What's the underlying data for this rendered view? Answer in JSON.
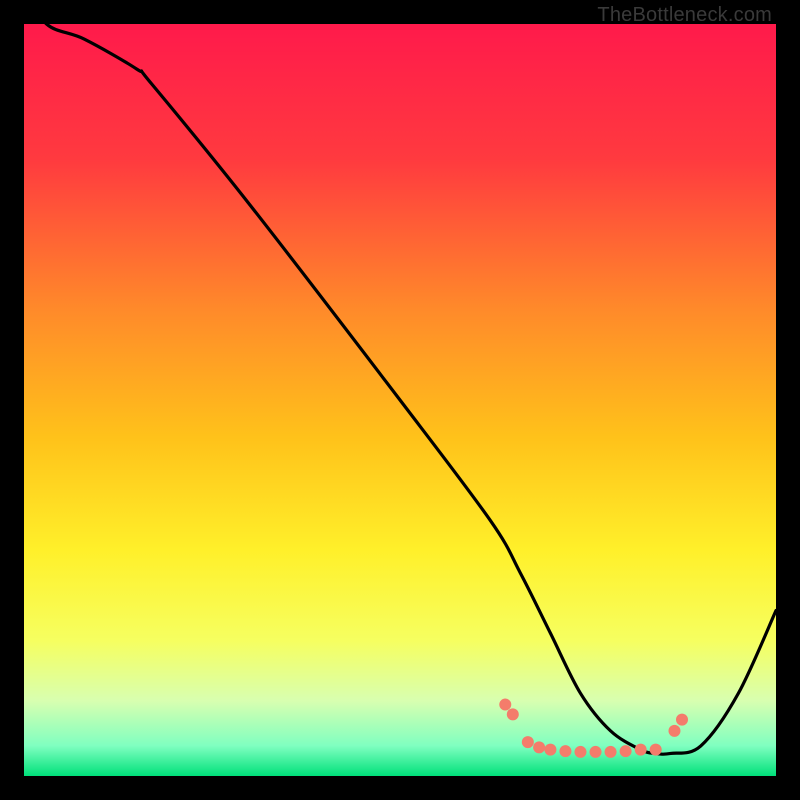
{
  "watermark": "TheBottleneck.com",
  "chart_data": {
    "type": "line",
    "title": "",
    "xlabel": "",
    "ylabel": "",
    "xlim": [
      0,
      100
    ],
    "ylim": [
      0,
      100
    ],
    "grid": false,
    "legend": false,
    "gradient_stops": [
      {
        "offset": 0,
        "color": "#ff1a4b"
      },
      {
        "offset": 18,
        "color": "#ff3a3f"
      },
      {
        "offset": 38,
        "color": "#ff8a2a"
      },
      {
        "offset": 55,
        "color": "#ffc21a"
      },
      {
        "offset": 70,
        "color": "#fff02a"
      },
      {
        "offset": 82,
        "color": "#f6ff60"
      },
      {
        "offset": 90,
        "color": "#d8ffb0"
      },
      {
        "offset": 96,
        "color": "#7fffc0"
      },
      {
        "offset": 100,
        "color": "#00e07a"
      }
    ],
    "series": [
      {
        "name": "bottleneck-curve",
        "x": [
          0,
          3,
          8,
          15,
          17,
          30,
          50,
          62,
          66,
          70,
          74,
          78,
          82,
          84,
          86,
          90,
          95,
          100
        ],
        "y": [
          105,
          100,
          98,
          94,
          92,
          76,
          50,
          34,
          27,
          19,
          11,
          6,
          3.5,
          3,
          3,
          4,
          11,
          22
        ]
      }
    ],
    "markers": {
      "name": "highlight-dots",
      "color": "#f47c6b",
      "radius": 6,
      "points": [
        {
          "x": 64,
          "y": 9.5
        },
        {
          "x": 65,
          "y": 8.2
        },
        {
          "x": 67,
          "y": 4.5
        },
        {
          "x": 68.5,
          "y": 3.8
        },
        {
          "x": 70,
          "y": 3.5
        },
        {
          "x": 72,
          "y": 3.3
        },
        {
          "x": 74,
          "y": 3.2
        },
        {
          "x": 76,
          "y": 3.2
        },
        {
          "x": 78,
          "y": 3.2
        },
        {
          "x": 80,
          "y": 3.3
        },
        {
          "x": 82,
          "y": 3.5
        },
        {
          "x": 84,
          "y": 3.5
        },
        {
          "x": 86.5,
          "y": 6.0
        },
        {
          "x": 87.5,
          "y": 7.5
        }
      ]
    }
  }
}
